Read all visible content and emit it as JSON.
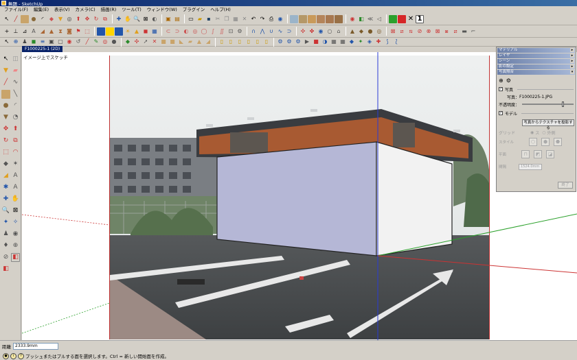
{
  "window": {
    "title": "無題 - SketchUp"
  },
  "menu": [
    "ファイル(F)",
    "編集(E)",
    "表示(V)",
    "カメラ(C)",
    "描画(R)",
    "ツール(T)",
    "ウィンドウ(W)",
    "プラグイン",
    "ヘルプ(H)"
  ],
  "tab": {
    "label": "F1000225-1 (2D)"
  },
  "viewport": {
    "scene_label": "イメージ上でスケッチ"
  },
  "dialogs": {
    "titles": [
      "マテリアル",
      "レイヤ",
      "シーン",
      "影の設定",
      "写真照合"
    ],
    "photo_match": {
      "photo_section": "写真",
      "photo_label": "写真：",
      "photo_file": "F1000225-1.JPG",
      "opacity_label": "不透明度：",
      "model_section": "モデル",
      "project_button": "写真からテクスチャを投影する",
      "grid_label": "グリッド",
      "grid_opt1": "ス",
      "grid_opt2": "外側",
      "style_label": "スタイル",
      "plane_label": "平面",
      "spacing_label": "間隔",
      "spacing_value": "1524.0mm",
      "done_button": "終了"
    }
  },
  "status": {
    "measure_label": "距離",
    "measure_value": "2333.9mm",
    "hint": "プッシュまたはプルする面を選択します。Ctrl = 新しい開始面を作成。"
  }
}
